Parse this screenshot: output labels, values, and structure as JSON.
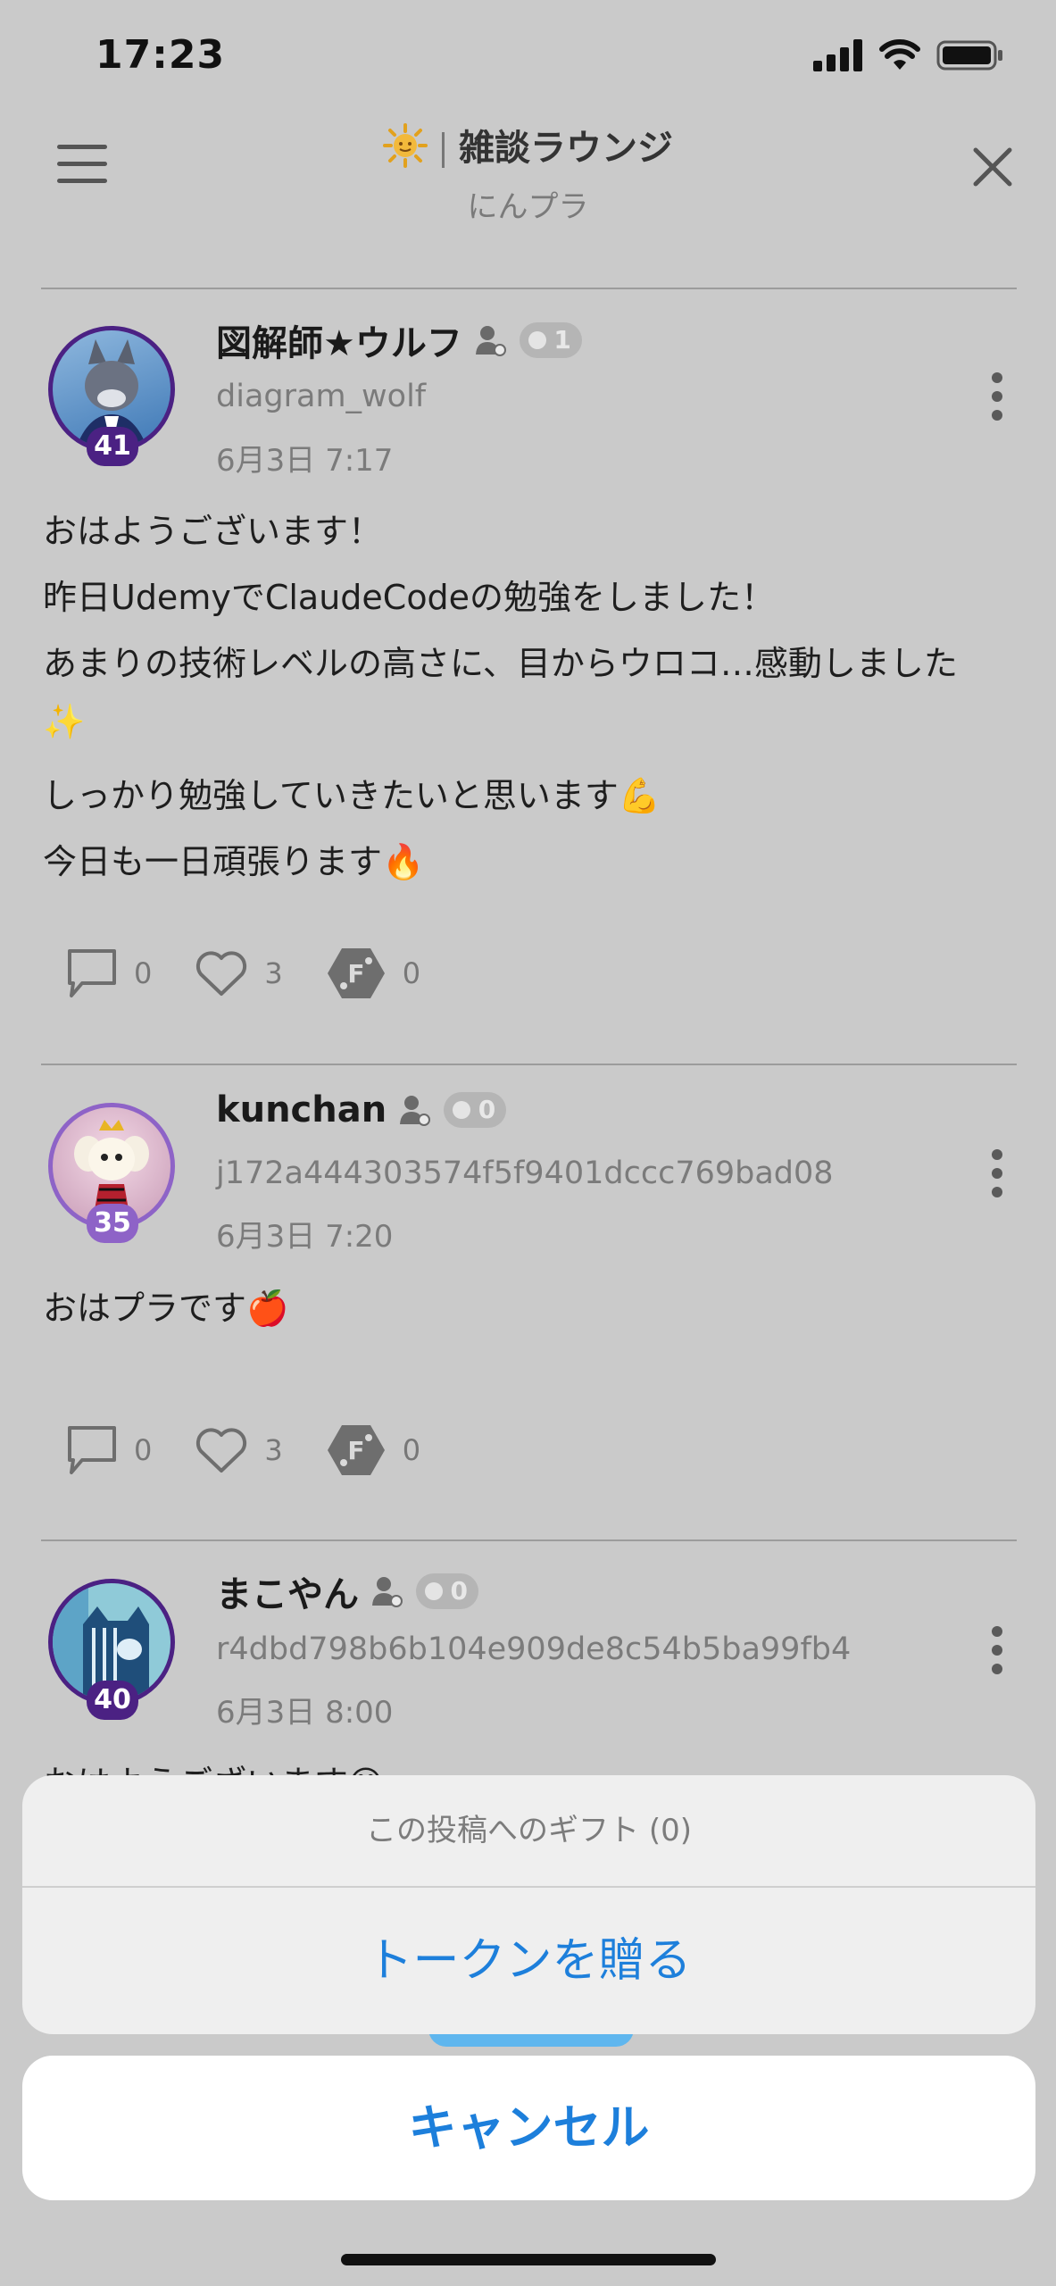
{
  "status_bar": {
    "time": "17:23"
  },
  "header": {
    "title": "雑談ラウンジ",
    "subtitle": "にんプラ"
  },
  "posts": [
    {
      "display_name": "図解師★ウルフ",
      "badge_count": "1",
      "user_id": "diagram_wolf",
      "date": "6月3日 7:17",
      "level": "41",
      "level_color": "#4b2183",
      "body": [
        "おはようございます！",
        "昨日UdemyでClaudeCodeの勉強をしました！",
        "あまりの技術レベルの高さに、目からウロコ…感動しました",
        "✨",
        "しっかり勉強していきたいと思います💪",
        "今日も一日頑張ります🔥"
      ],
      "comments": "0",
      "likes": "3",
      "gifts": "0"
    },
    {
      "display_name": "kunchan",
      "badge_count": "0",
      "user_id": "j172a444303574f5f9401dccc769bad08",
      "date": "6月3日 7:20",
      "level": "35",
      "level_color": "#8e63c7",
      "body": [
        "おはプラです🍎"
      ],
      "comments": "0",
      "likes": "3",
      "gifts": "0"
    },
    {
      "display_name": "まこやん",
      "badge_count": "0",
      "user_id": "r4dbd798b6b104e909de8c54b5ba99fb4",
      "date": "6月3日 8:00",
      "level": "40",
      "level_color": "#4b2183",
      "body": [
        "おはようございます😊"
      ]
    }
  ],
  "action_sheet": {
    "caption": "この投稿へのギフト (0)",
    "action_label": "トークンを贈る",
    "cancel_label": "キャンセル"
  },
  "icons": [
    "signal-icon",
    "wifi-icon",
    "battery-icon",
    "menu-icon",
    "close-icon",
    "sun-icon",
    "member-icon",
    "more-icon",
    "comment-icon",
    "heart-icon",
    "gift-token-icon"
  ],
  "colors": {
    "accent": "#1d7fdb",
    "background_dim": "#cacaca",
    "level_badge": "#4b2183"
  }
}
